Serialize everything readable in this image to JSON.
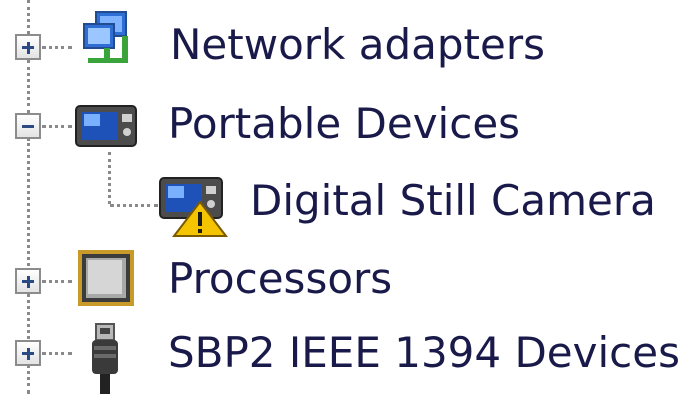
{
  "tree": {
    "items": [
      {
        "label": "Network adapters",
        "icon": "network-adapter-icon",
        "expander": "+",
        "expanded": false
      },
      {
        "label": "Portable Devices",
        "icon": "portable-device-icon",
        "expander": "−",
        "expanded": true
      },
      {
        "label": "Digital Still Camera",
        "icon": "camera-warning-icon",
        "expander": "",
        "expanded": false
      },
      {
        "label": "Processors",
        "icon": "processor-icon",
        "expander": "+",
        "expanded": false
      },
      {
        "label": "SBP2 IEEE 1394 Devices",
        "icon": "usb-connector-icon",
        "expander": "+",
        "expanded": false
      }
    ]
  },
  "colors": {
    "text": "#1a1a4a",
    "expander_sign": "#2b4a84",
    "connector": "#8a8a8a",
    "warning": "#f5c400"
  }
}
